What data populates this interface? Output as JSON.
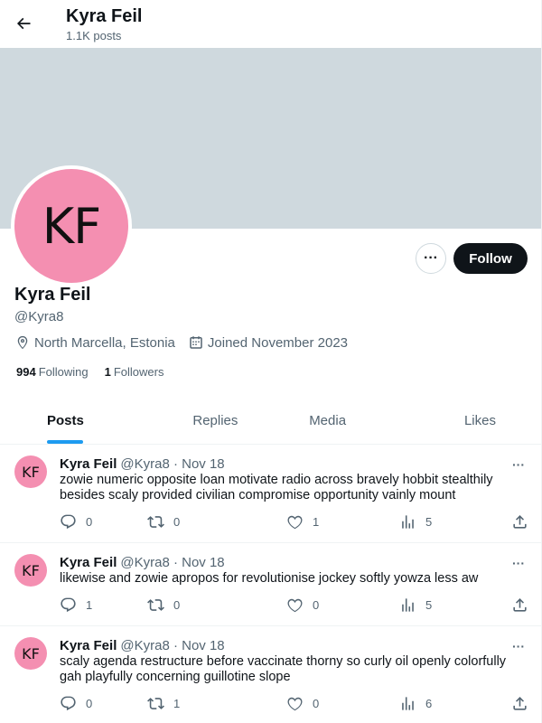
{
  "header": {
    "title": "Kyra Feil",
    "post_count": "1.1K posts"
  },
  "profile": {
    "avatar_initials": "KF",
    "name": "Kyra Feil",
    "handle": "@Kyra8",
    "location": "North Marcella, Estonia",
    "joined": "Joined November 2023",
    "following_count": "994",
    "following_label": "Following",
    "followers_count": "1",
    "followers_label": "Followers",
    "more_label": "···",
    "follow_label": "Follow"
  },
  "tabs": [
    {
      "label": "Posts",
      "active": true
    },
    {
      "label": "Replies",
      "active": false
    },
    {
      "label": "Media",
      "active": false
    },
    {
      "label": "Likes",
      "active": false
    }
  ],
  "posts": [
    {
      "avatar": "KF",
      "name": "Kyra Feil",
      "handle": "@Kyra8 · Nov 18",
      "text": "zowie numeric opposite loan motivate radio across bravely hobbit stealthily besides scaly provided civilian compromise opportunity vainly mount",
      "replies": "0",
      "reposts": "0",
      "likes": "1",
      "views": "5"
    },
    {
      "avatar": "KF",
      "name": "Kyra Feil",
      "handle": "@Kyra8 · Nov 18",
      "text": "likewise and zowie apropos for revolutionise jockey softly yowza less aw",
      "replies": "1",
      "reposts": "0",
      "likes": "0",
      "views": "5"
    },
    {
      "avatar": "KF",
      "name": "Kyra Feil",
      "handle": "@Kyra8 · Nov 18",
      "text": "scaly agenda restructure before vaccinate thorny so curly oil openly colorfully gah playfully concerning guillotine slope",
      "replies": "0",
      "reposts": "1",
      "likes": "0",
      "views": "6"
    }
  ],
  "colors": {
    "banner": "#cfd9de",
    "avatar": "#f48fb1",
    "accent": "#1d9bf0",
    "follow_button": "#0f1419"
  },
  "icons": {
    "back": "arrow-left-icon",
    "location": "location-pin-icon",
    "calendar": "calendar-icon",
    "reply": "reply-bubble-icon",
    "repost": "repost-icon",
    "like": "heart-icon",
    "views": "views-bar-icon",
    "share": "share-icon"
  }
}
